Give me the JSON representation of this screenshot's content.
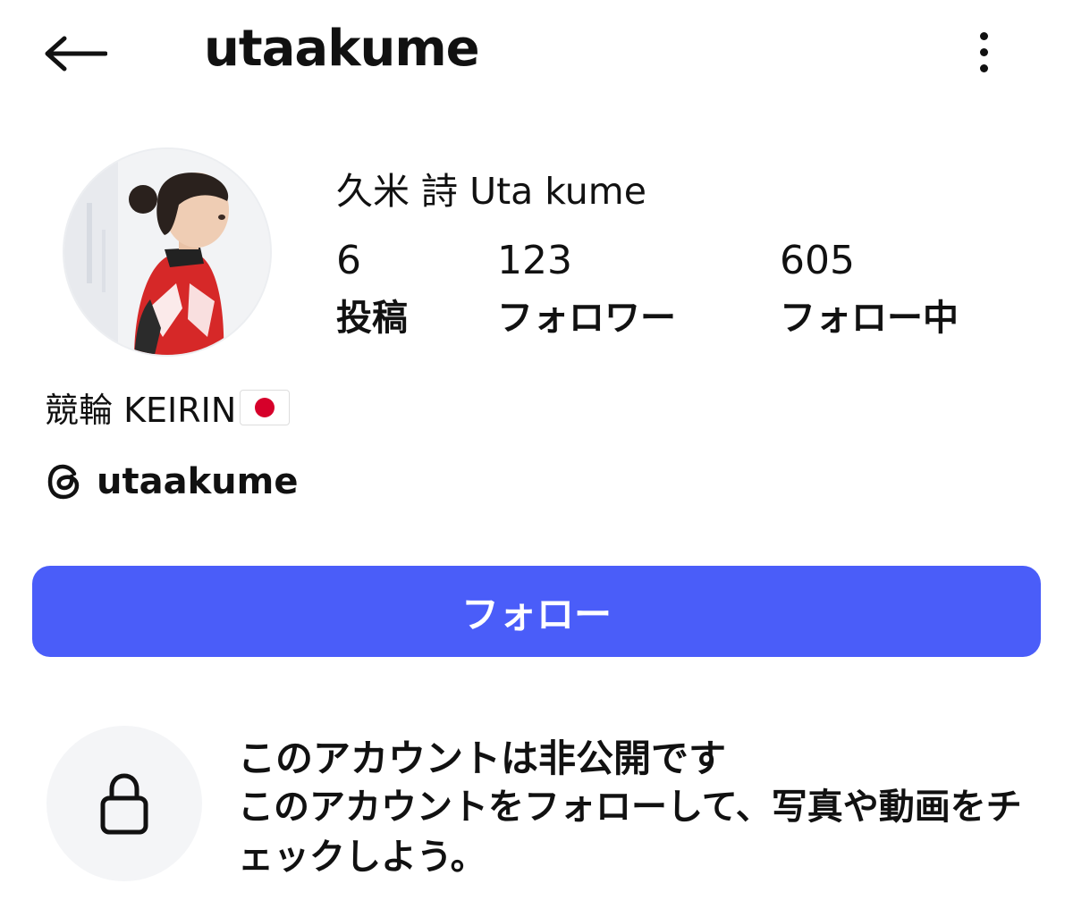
{
  "header": {
    "back_icon": "arrow-left-icon",
    "title": "utaakume",
    "more_icon": "more-vertical-icon"
  },
  "profile": {
    "full_name": "久米 詩 Uta kume",
    "stats": [
      {
        "value": "6",
        "label": "投稿"
      },
      {
        "value": "123",
        "label": "フォロワー"
      },
      {
        "value": "605",
        "label": "フォロー中"
      }
    ],
    "bio": "競輪 KEIRIN",
    "bio_emoji": "japan-flag",
    "threads": {
      "icon": "threads-icon",
      "handle": "utaakume"
    }
  },
  "follow_button": {
    "label": "フォロー",
    "color": "#4a5df9"
  },
  "private_notice": {
    "icon": "lock-icon",
    "title": "このアカウントは非公開です",
    "description": "このアカウントをフォローして、写真や動画をチェックしよう。"
  }
}
